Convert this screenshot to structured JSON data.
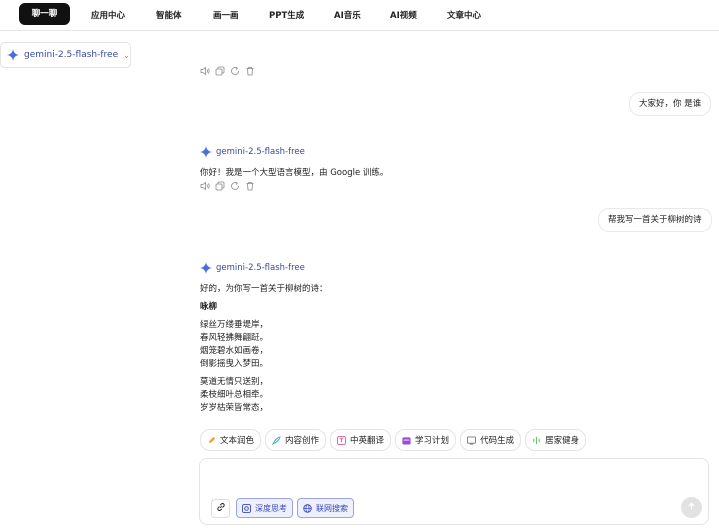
{
  "nav": {
    "items": [
      "聊一聊",
      "应用中心",
      "智能体",
      "画一画",
      "PPT生成",
      "AI音乐",
      "AI视频",
      "文章中心"
    ]
  },
  "model_selector": {
    "name": "gemini-2.5-flash-free",
    "chevron": "⌄"
  },
  "conversation": {
    "messages": [
      {
        "role": "user",
        "text": "大家好，你 是谁"
      },
      {
        "role": "assistant",
        "model": "gemini-2.5-flash-free",
        "text": "你好！我是一个大型语言模型，由 Google 训练。"
      },
      {
        "role": "user",
        "text": "帮我写一首关于柳树的诗"
      },
      {
        "role": "assistant",
        "model": "gemini-2.5-flash-free",
        "intro": "好的，为你写一首关于柳树的诗：",
        "poem_title": "咏柳",
        "stanza1": [
          "绿丝万缕垂堤岸，",
          "春风轻拂舞翩跹。",
          "烟笼碧水如画卷，",
          "倒影摇曳入梦田。"
        ],
        "stanza2": [
          "莫道无情只送别，",
          "柔枝细叶总相牵。",
          "岁岁枯荣皆常态，"
        ]
      }
    ],
    "action_icons": [
      "speaker-icon",
      "copy-icon",
      "refresh-icon",
      "trash-icon"
    ]
  },
  "chips": [
    {
      "label": "文本润色",
      "icon": "pen-icon",
      "color": "#f0a040"
    },
    {
      "label": "内容创作",
      "icon": "quill-icon",
      "color": "#3fb0d6"
    },
    {
      "label": "中英翻译",
      "icon": "translate-icon",
      "color": "#e0559a"
    },
    {
      "label": "学习计划",
      "icon": "plan-icon",
      "color": "#9a4ad8"
    },
    {
      "label": "代码生成",
      "icon": "code-icon",
      "color": "#777777"
    },
    {
      "label": "居家健身",
      "icon": "fitness-icon",
      "color": "#6cc06c"
    }
  ],
  "input": {
    "placeholder": "",
    "deep_think_label": "深度思考",
    "web_search_label": "联网搜索"
  },
  "colors": {
    "accent": "#3a4a9c",
    "toggle_bg": "#eef0fd",
    "toggle_border": "#9aa3e8"
  }
}
